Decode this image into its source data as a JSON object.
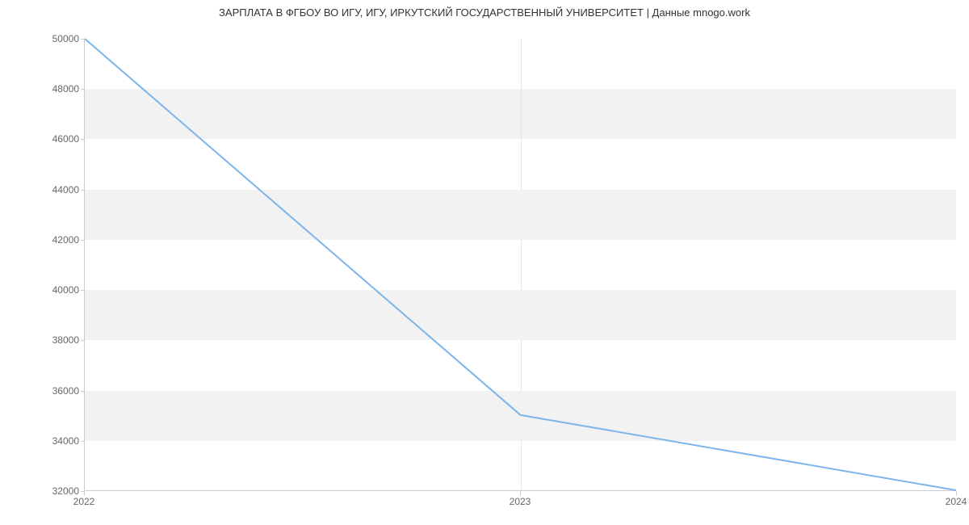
{
  "chart_data": {
    "type": "line",
    "title": "ЗАРПЛАТА В ФГБОУ ВО ИГУ, ИГУ, ИРКУТСКИЙ ГОСУДАРСТВЕННЫЙ УНИВЕРСИТЕТ | Данные mnogo.work",
    "x": [
      2022,
      2023,
      2024
    ],
    "values": [
      50000,
      35000,
      32000
    ],
    "xlim": [
      2022,
      2024
    ],
    "ylim": [
      32000,
      50000
    ],
    "xticks": [
      2022,
      2023,
      2024
    ],
    "yticks": [
      32000,
      34000,
      36000,
      38000,
      40000,
      42000,
      44000,
      46000,
      48000,
      50000
    ],
    "line_color": "#7cb5ec",
    "band_color": "#f2f2f2"
  }
}
